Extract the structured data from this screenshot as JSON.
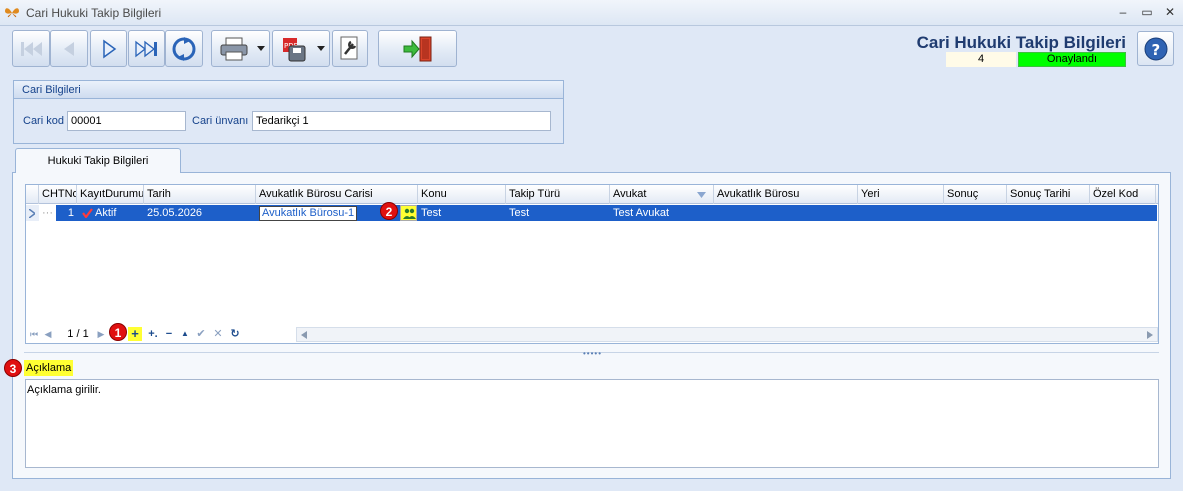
{
  "window": {
    "title": "Cari Hukuki Takip Bilgileri",
    "minimize_glyph": "–",
    "maximize_glyph": "▭",
    "close_glyph": "✕"
  },
  "header": {
    "form_title": "Cari Hukuki Takip Bilgileri",
    "record_count": "4",
    "status": "Onaylandı",
    "status_color": "#00ff00"
  },
  "toolbar": {
    "icons": [
      "first-record-icon",
      "previous-record-icon",
      "next-record-icon",
      "last-record-icon",
      "refresh-icon",
      "printer-icon",
      "pdf-export-icon",
      "tools-icon",
      "exit-door-icon"
    ]
  },
  "cari": {
    "group_title": "Cari Bilgileri",
    "kod_label": "Cari kod",
    "kod_value": "00001",
    "unvan_label": "Cari ünvanı",
    "unvan_value": "Tedarikçi 1"
  },
  "tab": {
    "label": "Hukuki Takip Bilgileri"
  },
  "grid": {
    "columns": [
      "CHTNo",
      "KayıtDurumu",
      "Tarih",
      "Avukatlık Bürosu Carisi",
      "Konu",
      "Takip Türü",
      "Avukat",
      "Avukatlık Bürosu",
      "Yeri",
      "Sonuç",
      "Sonuç Tarihi",
      "Özel Kod"
    ],
    "rows": [
      {
        "no": "1",
        "durum": "Aktif",
        "tarih": "25.05.2026",
        "buro_carisi": "Avukatlık Bürosu-1",
        "konu": "Test",
        "takip_turu": "Test",
        "avukat": "Test Avukat",
        "buro": "",
        "yeri": "",
        "sonuc": "",
        "sonuc_tarihi": "",
        "ozel_kod": ""
      }
    ],
    "selection_color": "#1d5fc9"
  },
  "navigator": {
    "page_indicator": "1 / 1",
    "first": "⏮",
    "prev": "◀",
    "next": "▶",
    "add": "+",
    "add_copy": "+.",
    "delete": "−",
    "up": "▲",
    "confirm": "✔",
    "cancel": "✕",
    "refresh": "↻"
  },
  "annotations": {
    "b1": "1",
    "b2": "2",
    "b3": "3"
  },
  "aciklama": {
    "label": "Açıklama",
    "value": "Açıklama girilir."
  }
}
